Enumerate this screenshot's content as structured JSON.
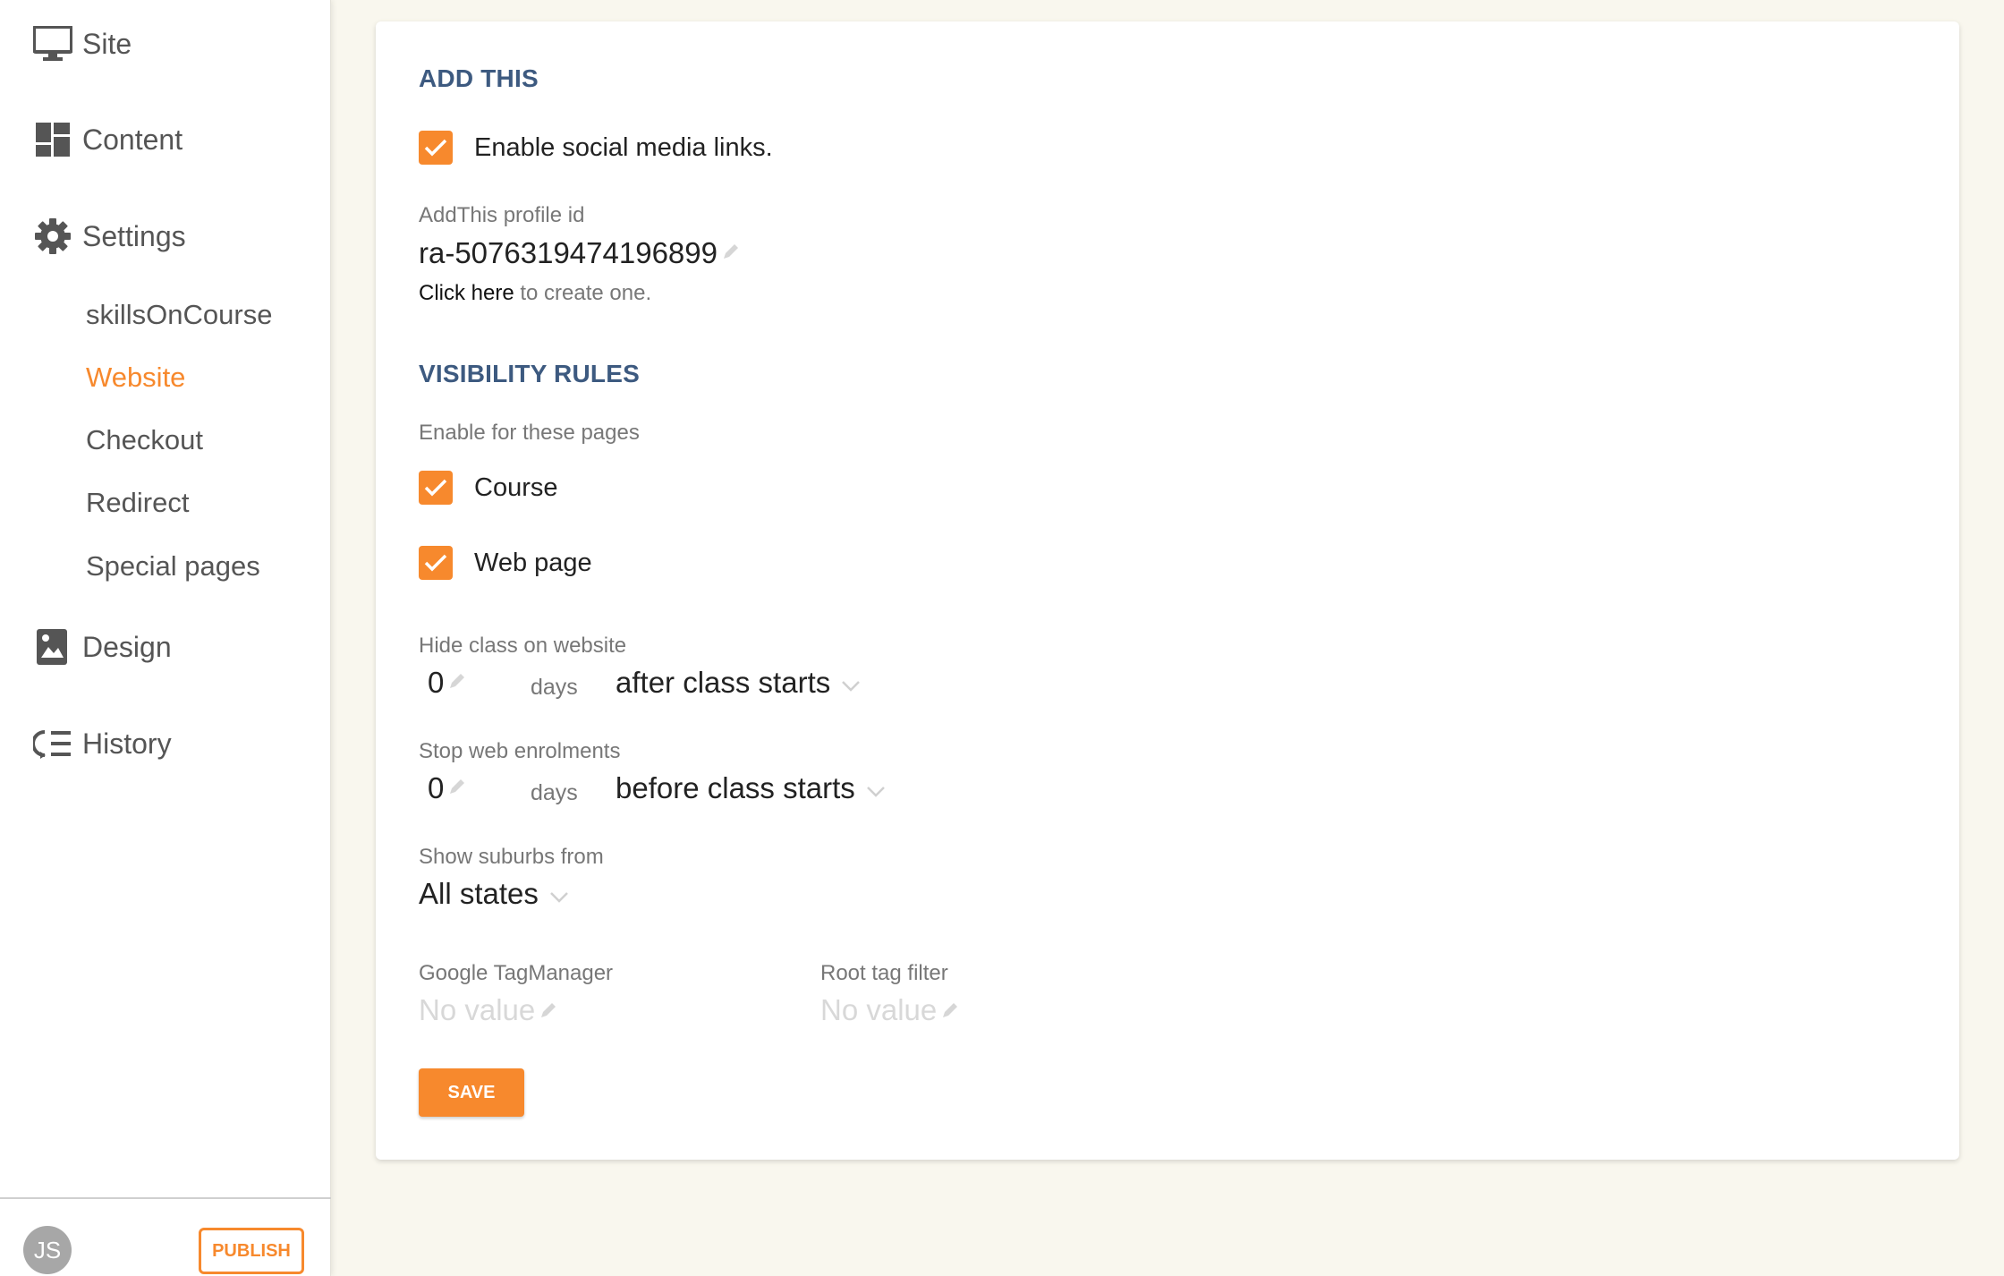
{
  "sidebar": {
    "nav": {
      "site": "Site",
      "content": "Content",
      "settings": "Settings",
      "design": "Design",
      "history": "History"
    },
    "settings_items": [
      "skillsOnCourse",
      "Website",
      "Checkout",
      "Redirect",
      "Special pages"
    ],
    "active_item": "Website",
    "avatar_initials": "JS",
    "publish_label": "PUBLISH"
  },
  "main": {
    "add_this": {
      "title": "ADD THIS",
      "enable_social": {
        "label": "Enable social media links.",
        "checked": true
      },
      "profile_id_label": "AddThis profile id",
      "profile_id_value": "ra-5076319474196899",
      "click_here": "Click here",
      "create_text": " to create one."
    },
    "visibility": {
      "title": "VISIBILITY RULES",
      "pages_label": "Enable for these pages",
      "pages": [
        {
          "label": "Course",
          "checked": true
        },
        {
          "label": "Web page",
          "checked": true
        }
      ],
      "hide_class": {
        "label": "Hide class on website",
        "value": "0",
        "unit": "days",
        "option": "after class starts"
      },
      "stop_enrol": {
        "label": "Stop web enrolments",
        "value": "0",
        "unit": "days",
        "option": "before class starts"
      },
      "suburbs": {
        "label": "Show suburbs from",
        "option": "All states"
      },
      "tag_manager": {
        "label": "Google TagManager",
        "placeholder": "No value"
      },
      "root_tag": {
        "label": "Root tag filter",
        "placeholder": "No value"
      }
    },
    "save_label": "SAVE"
  },
  "colors": {
    "accent": "#f7892d",
    "section_title": "#3d5a80",
    "background": "#f9f7ee"
  }
}
